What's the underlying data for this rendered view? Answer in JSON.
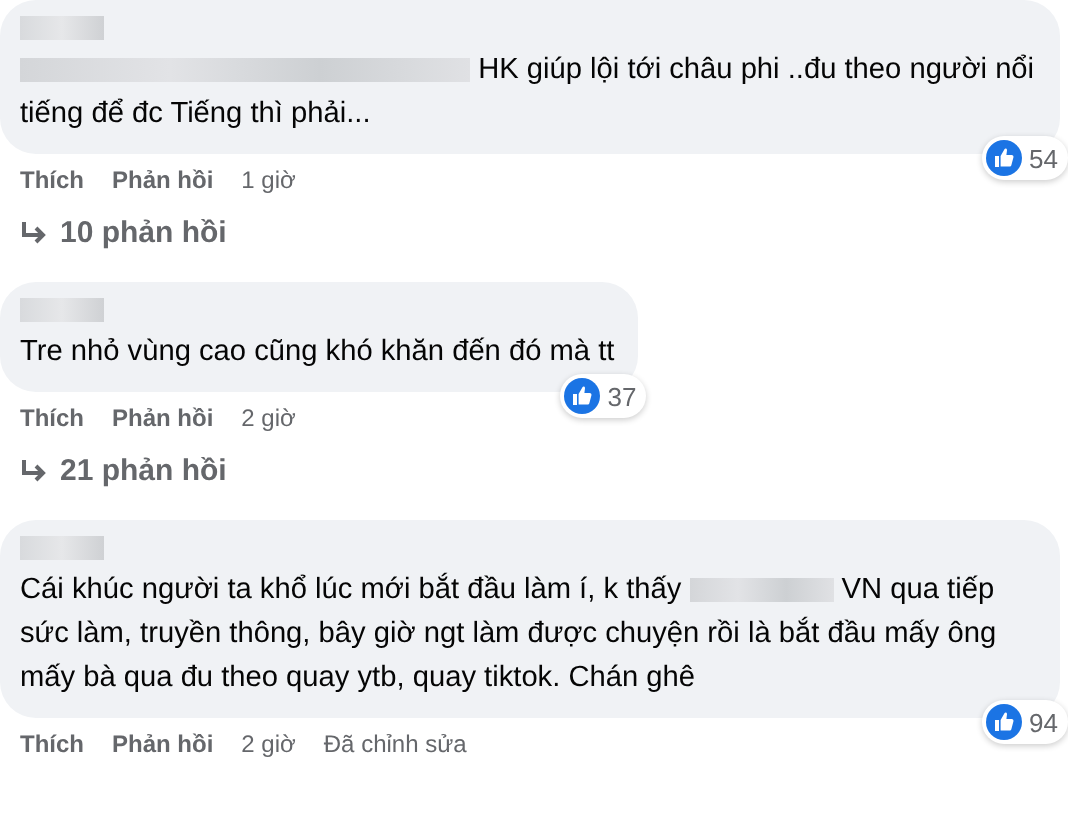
{
  "comments": [
    {
      "body": [
        {
          "kind": "redacted"
        },
        {
          "kind": "text",
          "text": "HK giúp lội tới châu phi ..đu theo người nổi tiếng để đc Tiếng thì phải..."
        }
      ],
      "actions": [
        "Thích",
        "Phản hồi"
      ],
      "time": "1 giờ",
      "likes": "54",
      "replies": "10 phản hồi"
    },
    {
      "body": [
        {
          "kind": "text",
          "text": "Tre nhỏ vùng cao cũng khó khăn đến đó mà tt"
        }
      ],
      "actions": [
        "Thích",
        "Phản hồi"
      ],
      "time": "2 giờ",
      "likes": "37",
      "replies": "21 phản hồi"
    },
    {
      "body": [
        {
          "kind": "text",
          "text": "Cái khúc người ta khổ lúc mới bắt đầu làm í, k thấy"
        },
        {
          "kind": "redacted"
        },
        {
          "kind": "text",
          "text": "VN qua tiếp sức làm, truyền thông, bây giờ ngt làm được chuyện rồi là bắt đầu mấy ông mấy bà qua đu theo quay ytb, quay tiktok. Chán ghê"
        }
      ],
      "actions": [
        "Thích",
        "Phản hồi"
      ],
      "time": "2 giờ",
      "edited": "Đã chỉnh sửa",
      "likes": "94"
    }
  ]
}
